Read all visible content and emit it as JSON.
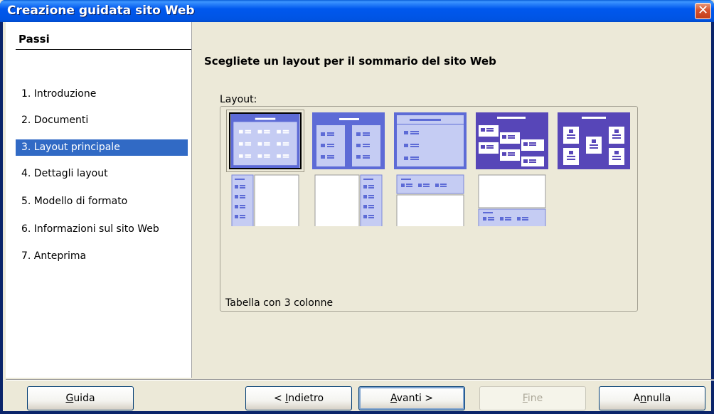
{
  "window": {
    "title": "Creazione guidata sito Web",
    "close_glyph": "✕"
  },
  "steps": {
    "title": "Passi",
    "items": [
      {
        "label": "1.  Introduzione"
      },
      {
        "label": "2.  Documenti"
      },
      {
        "label": "3.  Layout principale",
        "active": true
      },
      {
        "label": "4.  Dettagli layout"
      },
      {
        "label": "5.  Modello di formato"
      },
      {
        "label": "6.  Informazioni sul sito Web"
      },
      {
        "label": "7.  Anteprima"
      }
    ]
  },
  "main": {
    "title": "Scegliete un layout per il sommario del sito Web",
    "layout_label": "Layout:",
    "selected_description": "Tabella con 3 colonne"
  },
  "buttons": {
    "help": {
      "label": "Guida",
      "mnemonic": "G"
    },
    "back": {
      "label": "< Indietro",
      "mnemonic": "I"
    },
    "next": {
      "label": "Avanti >",
      "mnemonic": "A"
    },
    "finish": {
      "label": "Fine",
      "mnemonic": "F"
    },
    "cancel": {
      "label": "Annulla",
      "mnemonic": "n"
    }
  },
  "colors": {
    "accent": "#316AC5",
    "thumb_blue": "#5D6BD6",
    "thumb_light": "#C5CCF3",
    "thumb_dark": "#5746B8"
  }
}
